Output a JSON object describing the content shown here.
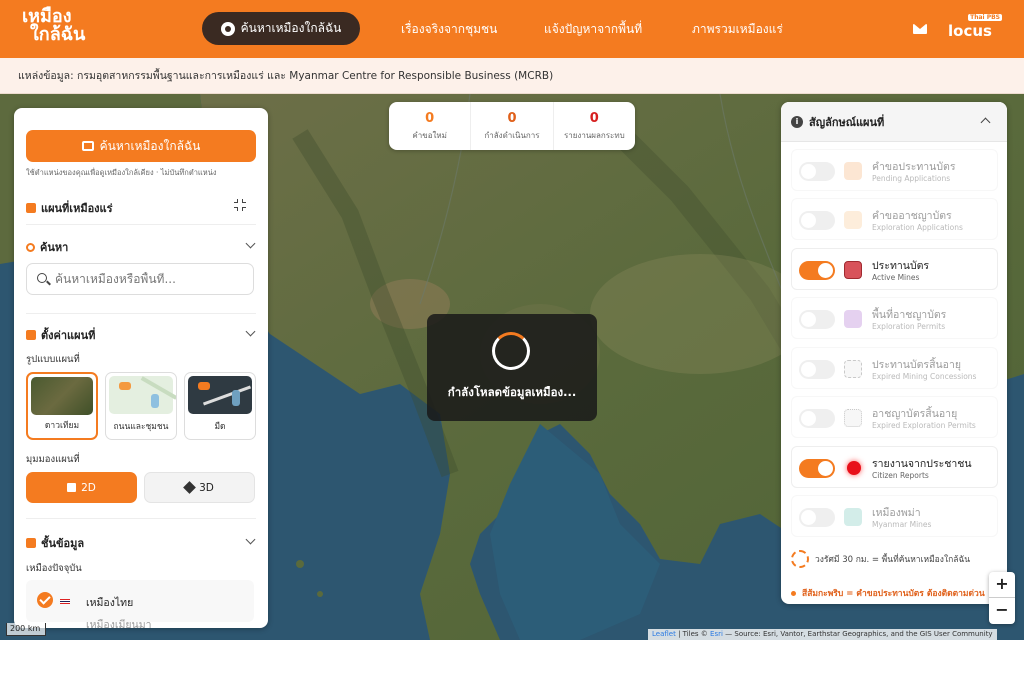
{
  "nav": {
    "logo_line1": "เหมือง",
    "logo_line2": "ใกล้ฉัน",
    "active_label": "ค้นหาเหมืองใกล้ฉัน",
    "links": [
      "เรื่องจริงจากชุมชน",
      "แจ้งปัญหาจากพื้นที่",
      "ภาพรวมเหมืองแร่"
    ],
    "locus_label": "locus",
    "locus_tag": "Thai PBS"
  },
  "source_text": "แหล่งข้อมูล: กรมอุตสาหกรรมพื้นฐานและการเหมืองแร่ และ Myanmar Centre for Responsible Business (MCRB)",
  "stats": [
    {
      "value": "0",
      "label": "คำขอใหม่",
      "color": "#f47b20"
    },
    {
      "value": "0",
      "label": "กำลังดำเนินการ",
      "color": "#e0601a"
    },
    {
      "value": "0",
      "label": "รายงานผลกระทบ",
      "color": "#d62020"
    }
  ],
  "loading_text": "กำลังโหลดข้อมูลเหมือง...",
  "left_panel": {
    "find_button": "ค้นหาเหมืองใกล้ฉัน",
    "hint": "ใช้ตำแหน่งของคุณเพื่อดูเหมืองใกล้เคียง · ไม่บันทึกตำแหน่ง",
    "title": "แผนที่เหมืองแร่",
    "search_title": "ค้นหา",
    "search_placeholder": "ค้นหาเหมืองหรือพื้นที่...",
    "settings_title": "ตั้งค่าแผนที่",
    "basemap_label": "รูปแบบแผนที่",
    "basemaps": [
      "ดาวเทียม",
      "ถนนและชุมชน",
      "มืด"
    ],
    "view_label": "มุมมองแผนที่",
    "view_2d": "2D",
    "view_3d": "3D",
    "layers_title": "ชั้นข้อมูล",
    "current_mines_label": "เหมืองปัจจุบัน",
    "layer_thai": "เหมืองไทย",
    "layer_myanmar": "เหมืองเมียนมา"
  },
  "scale_label": "200 km",
  "legend": {
    "title": "สัญลักษณ์แผนที่",
    "items": [
      {
        "name": "คำขอประทานบัตร",
        "sub": "Pending Applications",
        "color": "#f9c9a0",
        "on": false
      },
      {
        "name": "คำขออาชญาบัตร",
        "sub": "Exploration Applications",
        "color": "#fbd9b0",
        "on": false
      },
      {
        "name": "ประทานบัตร",
        "sub": "Active Mines",
        "color": "#d8525a",
        "on": true
      },
      {
        "name": "พื้นที่อาชญาบัตร",
        "sub": "Exploration Permits",
        "color": "#c69ade",
        "on": false
      },
      {
        "name": "ประทานบัตรสิ้นอายุ",
        "sub": "Expired Mining Concessions",
        "color": "#e2e2e2",
        "on": false
      },
      {
        "name": "อาชญาบัตรสิ้นอายุ",
        "sub": "Expired Exploration Permits",
        "color": "#e2e2e2",
        "on": false
      },
      {
        "name": "รายงานจากประชาชน",
        "sub": "Citizen Reports",
        "color": "#e8101a",
        "on": true
      },
      {
        "name": "เหมืองพม่า",
        "sub": "Myanmar Mines",
        "color": "#9fd8d0",
        "on": false
      }
    ],
    "radius_note": "วงรัศมี 30 กม. = พื้นที่ค้นหาเหมืองใกล้ฉัน",
    "blink_note": "สีส้มกะพริบ = คำขอประทานบัตร ต้องติดตามด่วน"
  },
  "zoom": {
    "in": "+",
    "out": "−"
  },
  "attribution": {
    "leaflet": "Leaflet",
    "rest": " | Tiles © ",
    "esri": "Esri",
    "source": " — Source: Esri, Vantor, Earthstar Geographics, and the GIS User Community"
  },
  "colors": {
    "accent": "#f47b20",
    "dark": "#3a2a22"
  }
}
